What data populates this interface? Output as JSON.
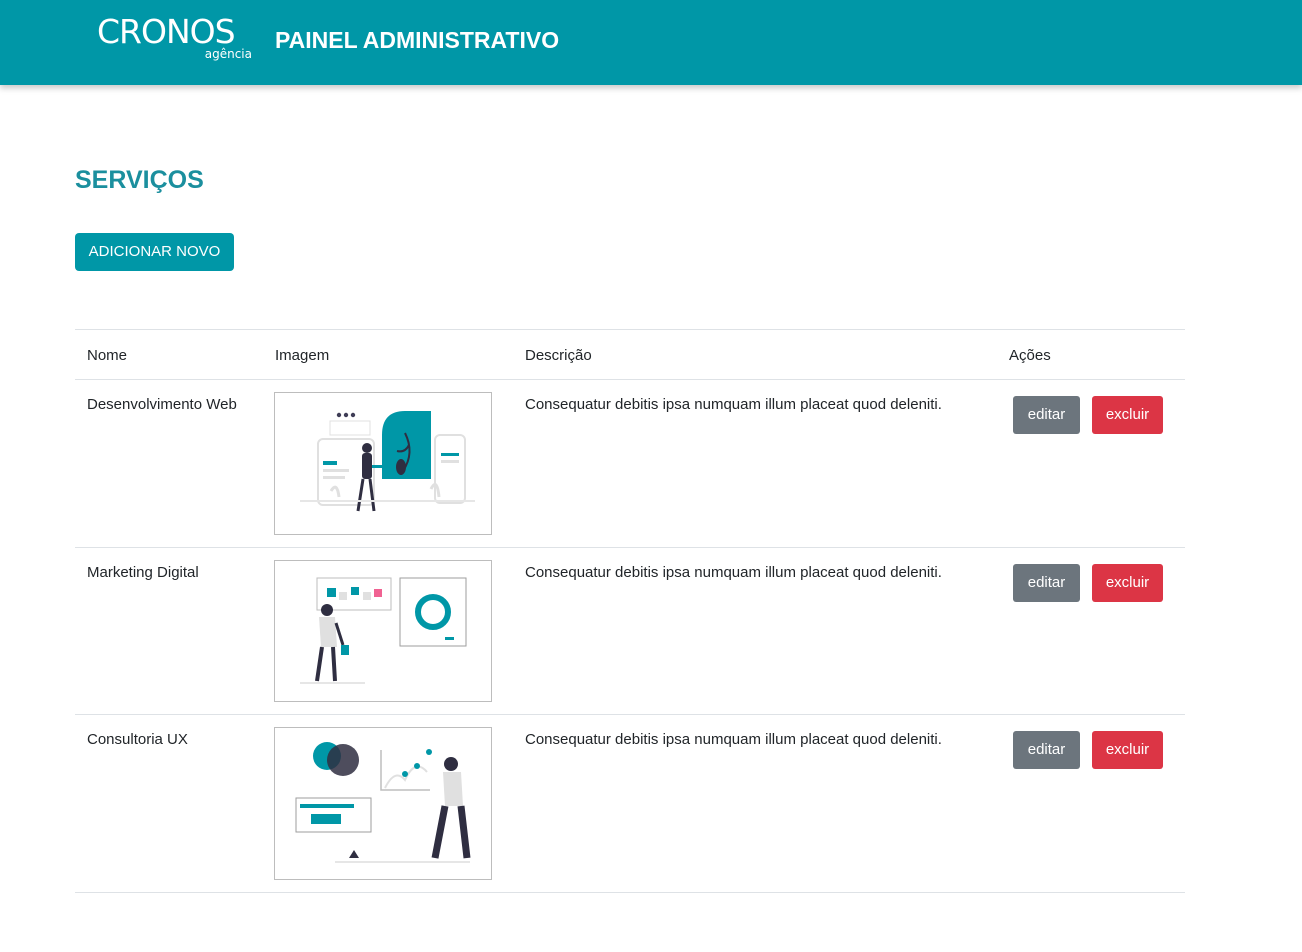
{
  "header": {
    "logo_main": "CRONOS",
    "logo_sub": "agência",
    "title": "PAINEL ADMINISTRATIVO"
  },
  "page": {
    "title": "SERVIÇOS",
    "add_button": "ADICIONAR NOVO"
  },
  "table": {
    "columns": [
      "Nome",
      "Imagem",
      "Descrição",
      "Ações"
    ],
    "rows": [
      {
        "name": "Desenvolvimento Web",
        "image_icon": "web-development-illustration",
        "description": "Consequatur debitis ipsa numquam illum placeat quod deleniti.",
        "edit_label": "editar",
        "delete_label": "excluir"
      },
      {
        "name": "Marketing Digital",
        "image_icon": "digital-marketing-illustration",
        "description": "Consequatur debitis ipsa numquam illum placeat quod deleniti.",
        "edit_label": "editar",
        "delete_label": "excluir"
      },
      {
        "name": "Consultoria UX",
        "image_icon": "ux-consulting-illustration",
        "description": "Consequatur debitis ipsa numquam illum placeat quod deleniti.",
        "edit_label": "editar",
        "delete_label": "excluir"
      }
    ]
  },
  "colors": {
    "brand": "#0097a7",
    "title": "#1b8f9e",
    "edit": "#6c757d",
    "delete": "#dc3545"
  }
}
